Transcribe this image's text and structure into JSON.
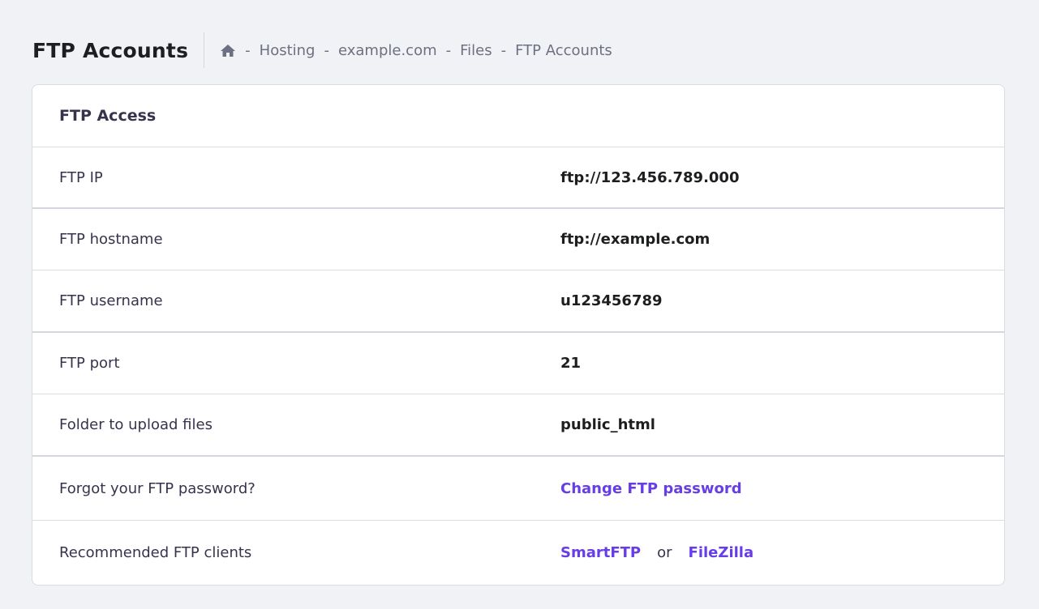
{
  "header": {
    "title": "FTP Accounts",
    "breadcrumb": {
      "home_icon": "home-icon",
      "separator": "-",
      "items": [
        "Hosting",
        "example.com",
        "Files",
        "FTP Accounts"
      ]
    }
  },
  "card": {
    "title": "FTP Access",
    "rows": [
      {
        "label": "FTP IP",
        "value": "ftp://123.456.789.000"
      },
      {
        "label": "FTP hostname",
        "value": "ftp://example.com"
      },
      {
        "label": "FTP username",
        "value": "u123456789"
      },
      {
        "label": "FTP port",
        "value": "21"
      },
      {
        "label": "Folder to upload files",
        "value": "public_html"
      }
    ],
    "password_row": {
      "label": "Forgot your FTP password?",
      "link": "Change FTP password"
    },
    "clients_row": {
      "label": "Recommended FTP clients",
      "client1": "SmartFTP",
      "or": "or",
      "client2": "FileZilla"
    }
  },
  "colors": {
    "background": "#f1f2f6",
    "link": "#673de6",
    "text_dark": "#1d1e20",
    "text_muted": "#6d7081"
  }
}
